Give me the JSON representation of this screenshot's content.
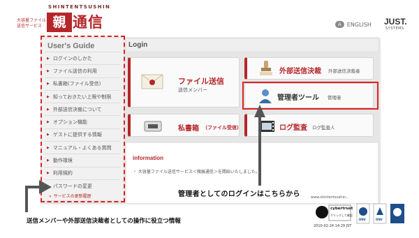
{
  "header": {
    "brand_en": "SHINTENTSUSHIN",
    "tagline": "大容量ファイル\n送信サービス",
    "logo_box": "親展",
    "logo_rest": "通信",
    "lang_badge": "A",
    "lang_label": "ENGLISH",
    "company": "JUST.",
    "company_sub": "SYSTEMS"
  },
  "sidebar": {
    "title": "User's Guide",
    "items": [
      {
        "label": "ログインのしかた"
      },
      {
        "label": "ファイル送信の利用"
      },
      {
        "label": "私書箱(ファイル受信)"
      },
      {
        "label": "知っておきたい上限や制限"
      },
      {
        "label": "外部送信決裁について"
      },
      {
        "label": "オプション機能"
      },
      {
        "label": "ゲストに提供する情報"
      },
      {
        "label": "マニュアル・よくある質問"
      },
      {
        "label": "動作環境"
      },
      {
        "label": "利用規約"
      },
      {
        "label": "パスワードの変更"
      }
    ],
    "update_history": "サービスの更新履歴"
  },
  "login": {
    "title": "Login",
    "tiles": {
      "file_send": {
        "label": "ファイル送信",
        "sub": "送信メンバー"
      },
      "inbox": {
        "label": "私書箱",
        "sub": "（ファイル受信）"
      },
      "external": {
        "label": "外部送信決裁",
        "sub": "外部送信決裁者"
      },
      "admin": {
        "label": "管理者ツール",
        "sub": "管理者"
      },
      "audit": {
        "label": "ログ監査",
        "sub": "ログ監査人"
      }
    }
  },
  "information": {
    "title": "information",
    "text": "・ 大容量ファイル送信サービス＜親展通信＞を開始いたしました。"
  },
  "callouts": {
    "admin": "管理者としてのログインはこちらから",
    "bottom": "送信メンバーや外部送信決裁者としての操作に役立つ情報"
  },
  "badges": {
    "url": "www.shintentsushin...",
    "trust_name": "cybertrust",
    "trust_sub": "クリックして確認",
    "trust_date": "2010-02-24 14:29 JST",
    "cert_label": "DNV"
  },
  "colors": {
    "brand_red": "#b5262a",
    "highlight_red": "#e02020",
    "panel_gray": "#e6e6e6"
  },
  "icons": [
    "envelope-icon",
    "mailbox-icon",
    "stamp-icon",
    "admin-user-icon",
    "film-log-icon",
    "arrow-up-icon",
    "arrow-corner-icon"
  ]
}
